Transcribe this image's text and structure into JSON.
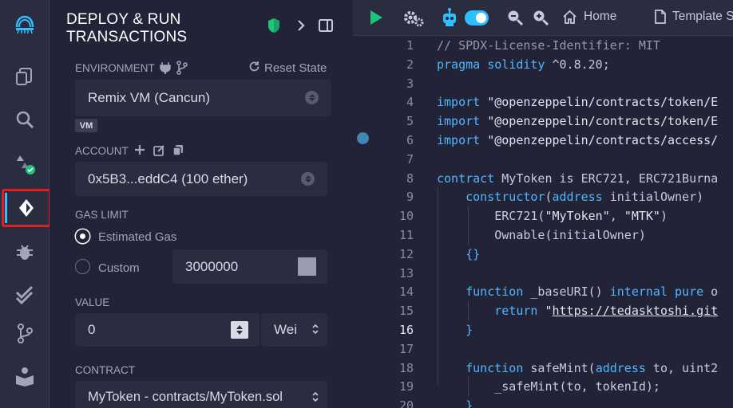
{
  "panel": {
    "title_line1": "DEPLOY & RUN",
    "title_line2": "TRANSACTIONS",
    "environment": {
      "label": "ENVIRONMENT",
      "reset_label": "Reset State",
      "value": "Remix VM (Cancun)",
      "badge": "VM"
    },
    "account": {
      "label": "ACCOUNT",
      "value": "0x5B3...eddC4 (100 ether)"
    },
    "gas_limit": {
      "label": "GAS LIMIT",
      "estimated_label": "Estimated Gas",
      "custom_label": "Custom",
      "custom_value": "3000000",
      "selected": "estimated"
    },
    "value": {
      "label": "VALUE",
      "amount": "0",
      "unit": "Wei"
    },
    "contract": {
      "label": "CONTRACT",
      "value": "MyToken - contracts/MyToken.sol"
    }
  },
  "toolbar": {
    "home_label": "Home",
    "template_label": "Template S"
  },
  "code": {
    "current_line": 16,
    "lines": [
      {
        "n": "1",
        "segments": [
          {
            "t": "// SPDX-License-Identifier: MIT",
            "c": "cmt"
          }
        ]
      },
      {
        "n": "2",
        "segments": [
          {
            "t": "pragma solidity",
            "c": "kw"
          },
          {
            "t": " ^0.8.20;",
            "c": ""
          }
        ]
      },
      {
        "n": "3",
        "segments": []
      },
      {
        "n": "4",
        "segments": [
          {
            "t": "import",
            "c": "kw"
          },
          {
            "t": " \"@openzeppelin/contracts/token/E",
            "c": "str"
          }
        ]
      },
      {
        "n": "5",
        "segments": [
          {
            "t": "import",
            "c": "kw"
          },
          {
            "t": " \"@openzeppelin/contracts/token/E",
            "c": "str"
          }
        ]
      },
      {
        "n": "6",
        "segments": [
          {
            "t": "import",
            "c": "kw"
          },
          {
            "t": " \"@openzeppelin/contracts/access/",
            "c": "str"
          }
        ]
      },
      {
        "n": "7",
        "segments": []
      },
      {
        "n": "8",
        "segments": [
          {
            "t": "contract",
            "c": "kw"
          },
          {
            "t": " MyToken is ERC721, ERC721Burna",
            "c": ""
          }
        ]
      },
      {
        "n": "9",
        "segments": [
          {
            "t": "    constructor",
            "c": "kw"
          },
          {
            "t": "(",
            "c": ""
          },
          {
            "t": "address",
            "c": "kw"
          },
          {
            "t": " initialOwner)",
            "c": ""
          }
        ]
      },
      {
        "n": "10",
        "segments": [
          {
            "t": "        ERC721(",
            "c": ""
          },
          {
            "t": "\"MyToken\"",
            "c": "str"
          },
          {
            "t": ", ",
            "c": ""
          },
          {
            "t": "\"MTK\"",
            "c": "str"
          },
          {
            "t": ")",
            "c": ""
          }
        ]
      },
      {
        "n": "11",
        "segments": [
          {
            "t": "        Ownable(initialOwner)",
            "c": ""
          }
        ]
      },
      {
        "n": "12",
        "segments": [
          {
            "t": "    {}",
            "c": "kw"
          }
        ]
      },
      {
        "n": "13",
        "segments": []
      },
      {
        "n": "14",
        "segments": [
          {
            "t": "    function",
            "c": "kw"
          },
          {
            "t": " _baseURI() ",
            "c": ""
          },
          {
            "t": "internal pure",
            "c": "kw"
          },
          {
            "t": " o",
            "c": ""
          }
        ]
      },
      {
        "n": "15",
        "segments": [
          {
            "t": "        return",
            "c": "kw"
          },
          {
            "t": " \"",
            "c": "str"
          },
          {
            "t": "https://tedasktoshi.git",
            "c": "str link"
          }
        ]
      },
      {
        "n": "16",
        "segments": [
          {
            "t": "    }",
            "c": "kw"
          }
        ]
      },
      {
        "n": "17",
        "segments": []
      },
      {
        "n": "18",
        "segments": [
          {
            "t": "    function",
            "c": "kw"
          },
          {
            "t": " safeMint(",
            "c": ""
          },
          {
            "t": "address",
            "c": "kw"
          },
          {
            "t": " to, uint2",
            "c": ""
          }
        ]
      },
      {
        "n": "19",
        "segments": [
          {
            "t": "        _safeMint(to, tokenId);",
            "c": ""
          }
        ]
      },
      {
        "n": "20",
        "segments": [
          {
            "t": "    }",
            "c": "kw"
          }
        ]
      }
    ]
  },
  "colors": {
    "accent": "#2fbfff",
    "highlight": "#e02020",
    "run_green": "#1fc37a"
  }
}
